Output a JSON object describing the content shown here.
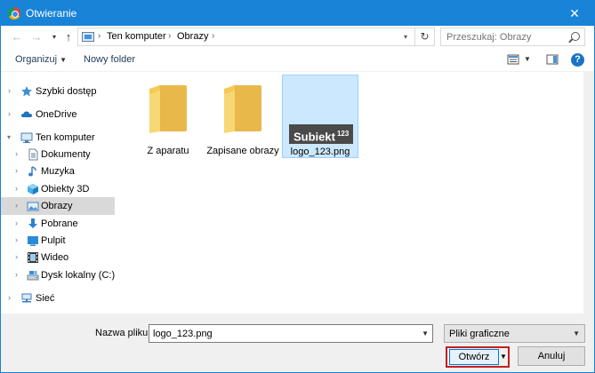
{
  "window": {
    "title": "Otwieranie",
    "close_glyph": "✕"
  },
  "address": {
    "crumbs": [
      "Ten komputer",
      "Obrazy"
    ],
    "search_placeholder": "Przeszukaj: Obrazy"
  },
  "toolbar": {
    "organize": "Organizuj",
    "new_folder": "Nowy folder",
    "help": "?"
  },
  "nav": {
    "items": [
      {
        "label": "Szybki dostęp",
        "icon": "star-icon",
        "indent": 0
      },
      {
        "label": "OneDrive",
        "icon": "cloud-icon",
        "indent": 0
      },
      {
        "label": "Ten komputer",
        "icon": "computer-icon",
        "indent": 0
      },
      {
        "label": "Dokumenty",
        "icon": "documents-icon",
        "indent": 1
      },
      {
        "label": "Muzyka",
        "icon": "music-icon",
        "indent": 1
      },
      {
        "label": "Obiekty 3D",
        "icon": "cube-icon",
        "indent": 1
      },
      {
        "label": "Obrazy",
        "icon": "pictures-icon",
        "indent": 1
      },
      {
        "label": "Pobrane",
        "icon": "download-icon",
        "indent": 1
      },
      {
        "label": "Pulpit",
        "icon": "desktop-icon",
        "indent": 1
      },
      {
        "label": "Wideo",
        "icon": "video-icon",
        "indent": 1
      },
      {
        "label": "Dysk lokalny (C:)",
        "icon": "drive-icon",
        "indent": 1
      },
      {
        "label": "Sieć",
        "icon": "network-icon",
        "indent": 0
      }
    ]
  },
  "files": [
    {
      "label": "Z aparatu",
      "kind": "folder"
    },
    {
      "label": "Zapisane obrazy",
      "kind": "folder"
    },
    {
      "label": "logo_123.png",
      "kind": "image",
      "thumb_text": "Subiekt",
      "thumb_sup": "123"
    }
  ],
  "footer": {
    "filename_label": "Nazwa pliku:",
    "filename_value": "logo_123.png",
    "filetype": "Pliki graficzne",
    "open": "Otwórz",
    "cancel": "Anuluj"
  },
  "colors": {
    "accent": "#1883d7",
    "selection": "#cce8ff",
    "highlight_border": "#c81e1e"
  }
}
